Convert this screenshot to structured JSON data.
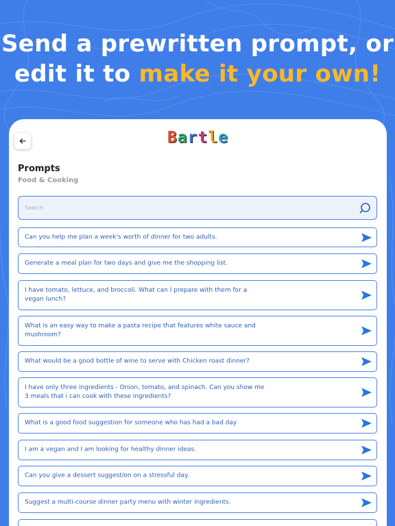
{
  "headline": {
    "line1": "Send a prewritten prompt, or",
    "line2_plain": "edit it to ",
    "line2_accent": "make it your own!"
  },
  "colors": {
    "background": "#3f7ee8",
    "accent": "#fbb829",
    "card": "#ffffff",
    "prompt_border": "#4a83e6",
    "prompt_text": "#2c5fb8"
  },
  "header": {
    "back_icon": "arrow-left-icon",
    "logo_letters": [
      "B",
      "a",
      "r",
      "t",
      "l",
      "e"
    ]
  },
  "section": {
    "title": "Prompts",
    "subtitle": "Food & Cooking"
  },
  "search": {
    "placeholder": "Search",
    "icon": "search-icon"
  },
  "prompts": [
    {
      "text": "Can you help me plan a week's worth of dinner for two adults."
    },
    {
      "text": "Generate a meal plan for two days and give me the shopping list."
    },
    {
      "text": "I have tomato, lettuce, and broccoli. What can I prepare with them for a vegan lunch?"
    },
    {
      "text": "What is an easy way to make a pasta recipe that features white sauce and mushroom?"
    },
    {
      "text": "What would be a good bottle of wine to serve with Chicken roast dinner?"
    },
    {
      "text": "I have only three ingredients - Onion, tomato, and spinach. Can you show me 3 meals that i can cook with these ingredients?"
    },
    {
      "text": "What is a good food suggestion for someone who has had a bad day"
    },
    {
      "text": "I am a vegan and I am looking for healthy dinner ideas."
    },
    {
      "text": "Can you give a dessert suggestion on a stressful day."
    },
    {
      "text": "Suggest a multi-course dinner party menu with winter ingredients."
    },
    {
      "text": ""
    }
  ]
}
